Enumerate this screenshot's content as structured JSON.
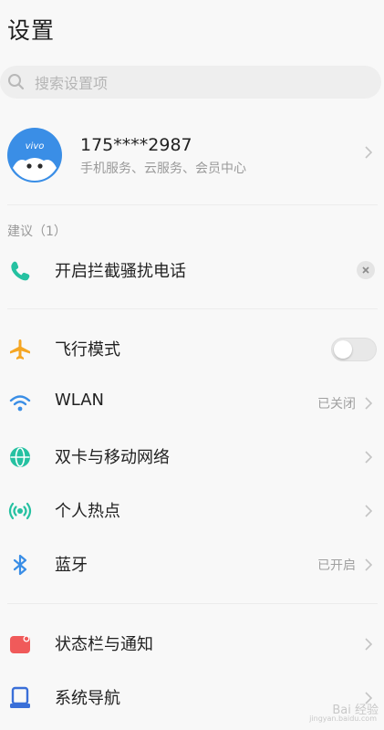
{
  "header": {
    "title": "设置"
  },
  "search": {
    "placeholder": "搜索设置项"
  },
  "account": {
    "logo_text": "vivo",
    "phone": "175****2987",
    "services": "手机服务、云服务、会员中心"
  },
  "suggestions": {
    "label": "建议（1）",
    "item": {
      "label": "开启拦截骚扰电话",
      "icon": "phone-icon"
    }
  },
  "settings": [
    {
      "label": "飞行模式",
      "icon": "airplane-icon",
      "toggle": false
    },
    {
      "label": "WLAN",
      "icon": "wifi-icon",
      "value": "已关闭"
    },
    {
      "label": "双卡与移动网络",
      "icon": "globe-icon"
    },
    {
      "label": "个人热点",
      "icon": "hotspot-icon"
    },
    {
      "label": "蓝牙",
      "icon": "bluetooth-icon",
      "value": "已开启"
    },
    {
      "label": "状态栏与通知",
      "icon": "notification-icon"
    },
    {
      "label": "系统导航",
      "icon": "navigation-icon"
    }
  ],
  "watermark": {
    "text": "Bai 经验",
    "sub": "jingyan.baidu.com"
  },
  "colors": {
    "accent_blue": "#3a8ee6",
    "phone_green": "#25c1a1",
    "airplane_orange": "#f5a623",
    "notification_red": "#f05a5a"
  }
}
